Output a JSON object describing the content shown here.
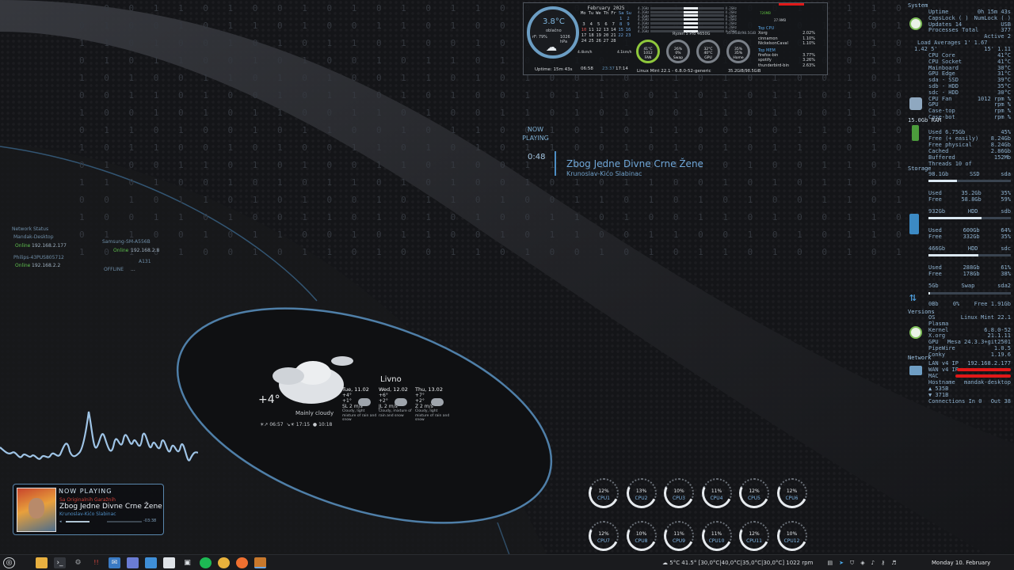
{
  "top_widget": {
    "temperature": "3.8°C",
    "condition": "oblačno",
    "humidity": "rF: 79%",
    "pressure": "1026 hPa",
    "uptime": "Uptime: 15m 43s",
    "sunrise": "06:58",
    "moon_time": "23:37",
    "sunset": "17:14",
    "wind_left": "4.4km/h",
    "wind_right": "4.1km/h",
    "calendar": {
      "title": "February 2025",
      "header": [
        "Mo",
        "Tu",
        "We",
        "Th",
        "Fr",
        "Sa",
        "Su"
      ],
      "weeks": [
        [
          "",
          "",
          "",
          "",
          "",
          "1",
          "2"
        ],
        [
          "3",
          "4",
          "5",
          "6",
          "7",
          "8",
          "9"
        ],
        [
          "10",
          "11",
          "12",
          "13",
          "14",
          "15",
          "16"
        ],
        [
          "17",
          "18",
          "19",
          "20",
          "21",
          "22",
          "23"
        ],
        [
          "24",
          "25",
          "26",
          "27",
          "28",
          "",
          ""
        ]
      ]
    },
    "cpu_model": "Ryzen 5 Pro 4650G",
    "mem_line": "35.2GiB/98.5GiB",
    "os_line": "Linux Mint 22.1 - 6.8.0-52-generic",
    "storage_line": "35.2GiB/98.5GiB",
    "ram_badge": "726MB",
    "ram_badge2": "27.9MB",
    "gauges": [
      {
        "label": "FAN",
        "v1": "41°C",
        "v2": "1012",
        "sub": "CPU"
      },
      {
        "label": "Swap",
        "v1": "26%",
        "v2": "0%",
        "sub": "RAM"
      },
      {
        "label": "GPU",
        "v1": "32°C",
        "v2": "40°C",
        "sub": "SSD"
      },
      {
        "label": "Home",
        "v1": "35%",
        "v2": "35%",
        "sub": "System"
      }
    ],
    "top_cpu": {
      "title": "Top CPU",
      "rows": [
        {
          "name": "Xorg",
          "val": "2.02%"
        },
        {
          "name": "cinnamon",
          "val": "1.10%"
        },
        {
          "name": "NickelsonCaval",
          "val": "1.10%"
        }
      ]
    },
    "top_mem": {
      "title": "Top MEM",
      "rows": [
        {
          "name": "firefox-bin",
          "val": "3.77%"
        },
        {
          "name": "spotify",
          "val": "3.26%"
        },
        {
          "name": "thunderbird-bin",
          "val": "2.63%"
        }
      ]
    },
    "core_rows": [
      {
        "ghz": "4.2GHz",
        "pct": "4.2GHz"
      },
      {
        "ghz": "4.2GHz",
        "pct": "4.2GHz"
      },
      {
        "ghz": "4.2GHz",
        "pct": "4.2GHz"
      },
      {
        "ghz": "4.2GHz",
        "pct": "4.2GHz"
      },
      {
        "ghz": "4.2GHz",
        "pct": "4.2GHz"
      },
      {
        "ghz": "4.2GHz",
        "pct": "4.2GHz"
      },
      {
        "ghz": "4.2GHz",
        "pct": "4.2GHz"
      }
    ]
  },
  "now_playing_mid": {
    "label": "NOW PLAYING",
    "time": "0:48",
    "title": "Zbog Jedne Divne Crne Žene",
    "artist": "Krunoslav-Kićo Slabinac"
  },
  "network_status": {
    "title": "Network Status",
    "devices": [
      {
        "name": "Mandak-Desktop",
        "status": "Online",
        "ip": "192.168.2.177"
      },
      {
        "name": "Samsung-SM-A556B",
        "status": "Online",
        "ip": "192.168.2.8"
      },
      {
        "name": "Philips-43PUS805712",
        "status": "Online",
        "ip": "192.168.2.2"
      },
      {
        "name": "A131",
        "status": "OFFLINE",
        "ip": "..."
      }
    ]
  },
  "weather": {
    "temp": "+4°",
    "condition": "Mainly cloudy",
    "city": "Livno",
    "sunrise": "06:57",
    "sunset": "17:15",
    "moon": "10:18",
    "days": [
      {
        "name": "Tue, 11.02",
        "hi": "+4°",
        "lo": "+1°",
        "wind": "SL 2 m/s",
        "desc": "Cloudy, light mixture of rain and snow"
      },
      {
        "name": "Wed, 12.02",
        "hi": "+6°",
        "lo": "+2°",
        "wind": "JL 2 m/s",
        "desc": "Cloudy, mixture of rain and snow"
      },
      {
        "name": "Thu, 13.02",
        "hi": "+7°",
        "lo": "+2°",
        "wind": "Z 2 m/s",
        "desc": "Cloudy, light mixture of rain and snow"
      }
    ]
  },
  "player": {
    "label": "NOW PLAYING",
    "album": "Sa Originalnih Garažnih",
    "title": "Zbog Jedne Divne Crne Žene",
    "artist": "Krunoslav-Kićo Slabinac",
    "elapsed": "0:48",
    "remaining": "-03:38",
    "progress": 0.2
  },
  "cpus": [
    {
      "label": "CPU1",
      "value": "12%"
    },
    {
      "label": "CPU2",
      "value": "13%"
    },
    {
      "label": "CPU3",
      "value": "10%"
    },
    {
      "label": "CPU4",
      "value": "11%"
    },
    {
      "label": "CPU5",
      "value": "12%"
    },
    {
      "label": "CPU6",
      "value": "12%"
    },
    {
      "label": "CPU7",
      "value": "12%"
    },
    {
      "label": "CPU8",
      "value": "10%"
    },
    {
      "label": "CPU9",
      "value": "11%"
    },
    {
      "label": "CPU10",
      "value": "11%"
    },
    {
      "label": "CPU11",
      "value": "12%"
    },
    {
      "label": "CPU12",
      "value": "10%"
    }
  ],
  "system_panel": {
    "system_title": "System",
    "system_rows": [
      [
        "Uptime",
        "0h 15m 43s"
      ],
      [
        "CapsLock ( )",
        "NumLock ( )"
      ],
      [
        "Updates 14",
        "USB"
      ],
      [
        "Processes Total",
        "377"
      ],
      [
        "",
        "Active 2"
      ]
    ],
    "load_title": "Load Averages 1' 1.67",
    "load_row": [
      "1.42  5'",
      "15'  1.11"
    ],
    "sensor_rows": [
      [
        "CPU Core",
        "41°C"
      ],
      [
        "CPU Socket",
        "41°C"
      ],
      [
        "Mainboard",
        "30°C"
      ],
      [
        "GPU Edge",
        "31°C"
      ],
      [
        "sda - SSD",
        "39°C"
      ],
      [
        "sdb - HDD",
        "35°C"
      ],
      [
        "sdc - HDD",
        "30°C"
      ],
      [
        "CPU Fan",
        "1012 rpm %"
      ],
      [
        "GPU",
        "rpm %"
      ],
      [
        "Case-top",
        "rpm %"
      ],
      [
        "Case-bot",
        "rpm %"
      ]
    ],
    "ram_title": "15.0Gb RAM",
    "ram_rows": [
      [
        "Used   6.75Gb",
        "45%"
      ],
      [
        "Free (+ easily)",
        "8.24Gb"
      ],
      [
        "Free physical",
        "8.24Gb"
      ],
      [
        "Cached",
        "2.86Gb"
      ],
      [
        "Buffered",
        "152Mb"
      ],
      [
        "Threads  10  of",
        ""
      ]
    ],
    "storage_title": "Storage",
    "disks": [
      {
        "size": "98.1Gb",
        "type": "SSD",
        "dev": "sda",
        "used": "35.2Gb",
        "used_pct": "35%",
        "free": "58.8Gb",
        "free_pct": "59%",
        "fill": 0.35
      },
      {
        "size": "932Gb",
        "type": "HDD",
        "dev": "sdb",
        "used": "600Gb",
        "used_pct": "64%",
        "free": "332Gb",
        "free_pct": "35%",
        "fill": 0.64
      },
      {
        "size": "466Gb",
        "type": "HDD",
        "dev": "sdc",
        "used": "288Gb",
        "used_pct": "61%",
        "free": "178Gb",
        "free_pct": "38%",
        "fill": 0.61
      }
    ],
    "swap": {
      "size": "5Gb",
      "label": "Swap",
      "dev": "sda2",
      "used": "0Bb",
      "pct": "0%",
      "free": "Free 1.91Gb"
    },
    "versions_title": "Versions",
    "versions": [
      [
        "OS",
        "Linux Mint 22.1"
      ],
      [
        "Plasma",
        ""
      ],
      [
        "Kernel",
        "6.8.0-52"
      ],
      [
        "X.org",
        "21.1.11"
      ],
      [
        "GPU",
        "Mesa 24.3.3+git2501"
      ],
      [
        "PipeWire",
        "1.0.5"
      ],
      [
        "Conky",
        "1.19.6"
      ]
    ],
    "network_title": "Network",
    "network_rows": [
      [
        "LAN v4 IP",
        "192.168.2.177"
      ],
      [
        "WAN v4 IP",
        ""
      ],
      [
        "MAC",
        ""
      ],
      [
        "Hostname",
        "mandak-desktop"
      ],
      [
        "▲ 535B",
        ""
      ],
      [
        "▼ 371B",
        ""
      ],
      [
        "Connections In 0",
        "Out 38"
      ]
    ]
  },
  "taskbar": {
    "tray_text": "5°C  41.5°  [30,0°C|40,0°C|35,0°C|30,0°C] 1022 rpm",
    "clock": "Monday 10. February 21:28:08"
  }
}
